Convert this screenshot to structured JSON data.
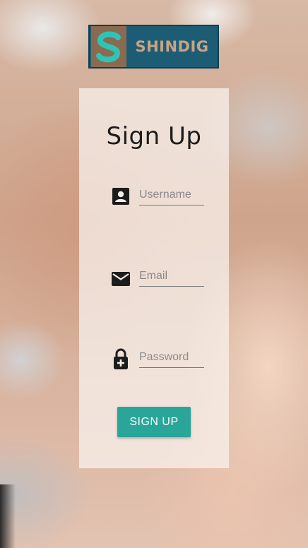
{
  "brand": {
    "name": "SHINDIG",
    "mark_letter": "S",
    "colors": {
      "background": "#1d5c75",
      "text": "#c9a383",
      "mark_bg": "#8a6a50",
      "mark_letter": "#2ec4b6"
    }
  },
  "form": {
    "title": "Sign Up",
    "fields": {
      "username": {
        "placeholder": "Username",
        "value": "",
        "icon": "account-box-icon"
      },
      "email": {
        "placeholder": "Email",
        "value": "",
        "icon": "envelope-icon"
      },
      "password": {
        "placeholder": "Password",
        "value": "",
        "icon": "lock-plus-icon"
      }
    },
    "submit_label": "SIGN UP",
    "accent": "#2aa59a"
  }
}
